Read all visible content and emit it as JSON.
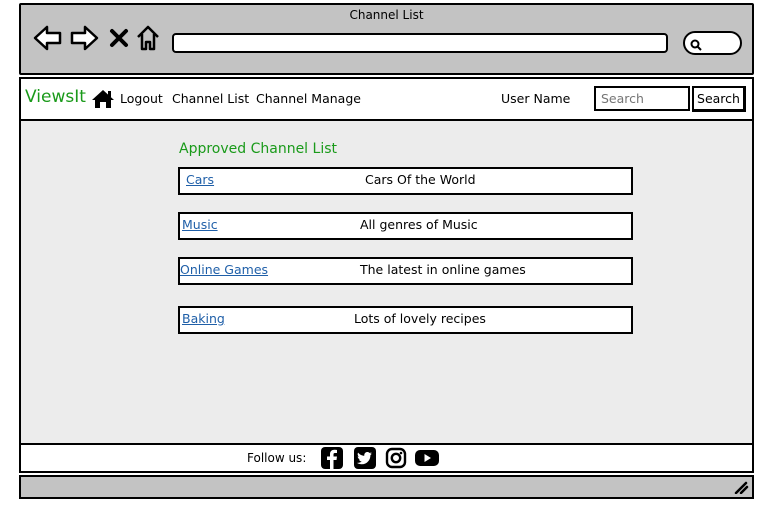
{
  "window": {
    "title": "Channel List"
  },
  "navbar": {
    "brand": "ViewsIt",
    "links": [
      "Logout",
      "Channel List",
      "Channel Manage"
    ],
    "user_name": "User Name",
    "search_placeholder": "Search",
    "search_button": "Search"
  },
  "main": {
    "section_title": "Approved Channel List",
    "channels": [
      {
        "name": "Cars",
        "description": "Cars Of the World"
      },
      {
        "name": "Music",
        "description": "All genres of Music"
      },
      {
        "name": "Online Games",
        "description": "The latest in online games"
      },
      {
        "name": "Baking",
        "description": "Lots of lovely recipes"
      }
    ]
  },
  "footer": {
    "follow_label": "Follow us:",
    "social_icons": [
      "facebook-icon",
      "twitter-icon",
      "instagram-icon",
      "youtube-icon"
    ]
  },
  "colors": {
    "brand": "#1a9a1a",
    "link": "#1f5fa8",
    "chrome": "#c3c3c3",
    "content_bg": "#ececec"
  }
}
